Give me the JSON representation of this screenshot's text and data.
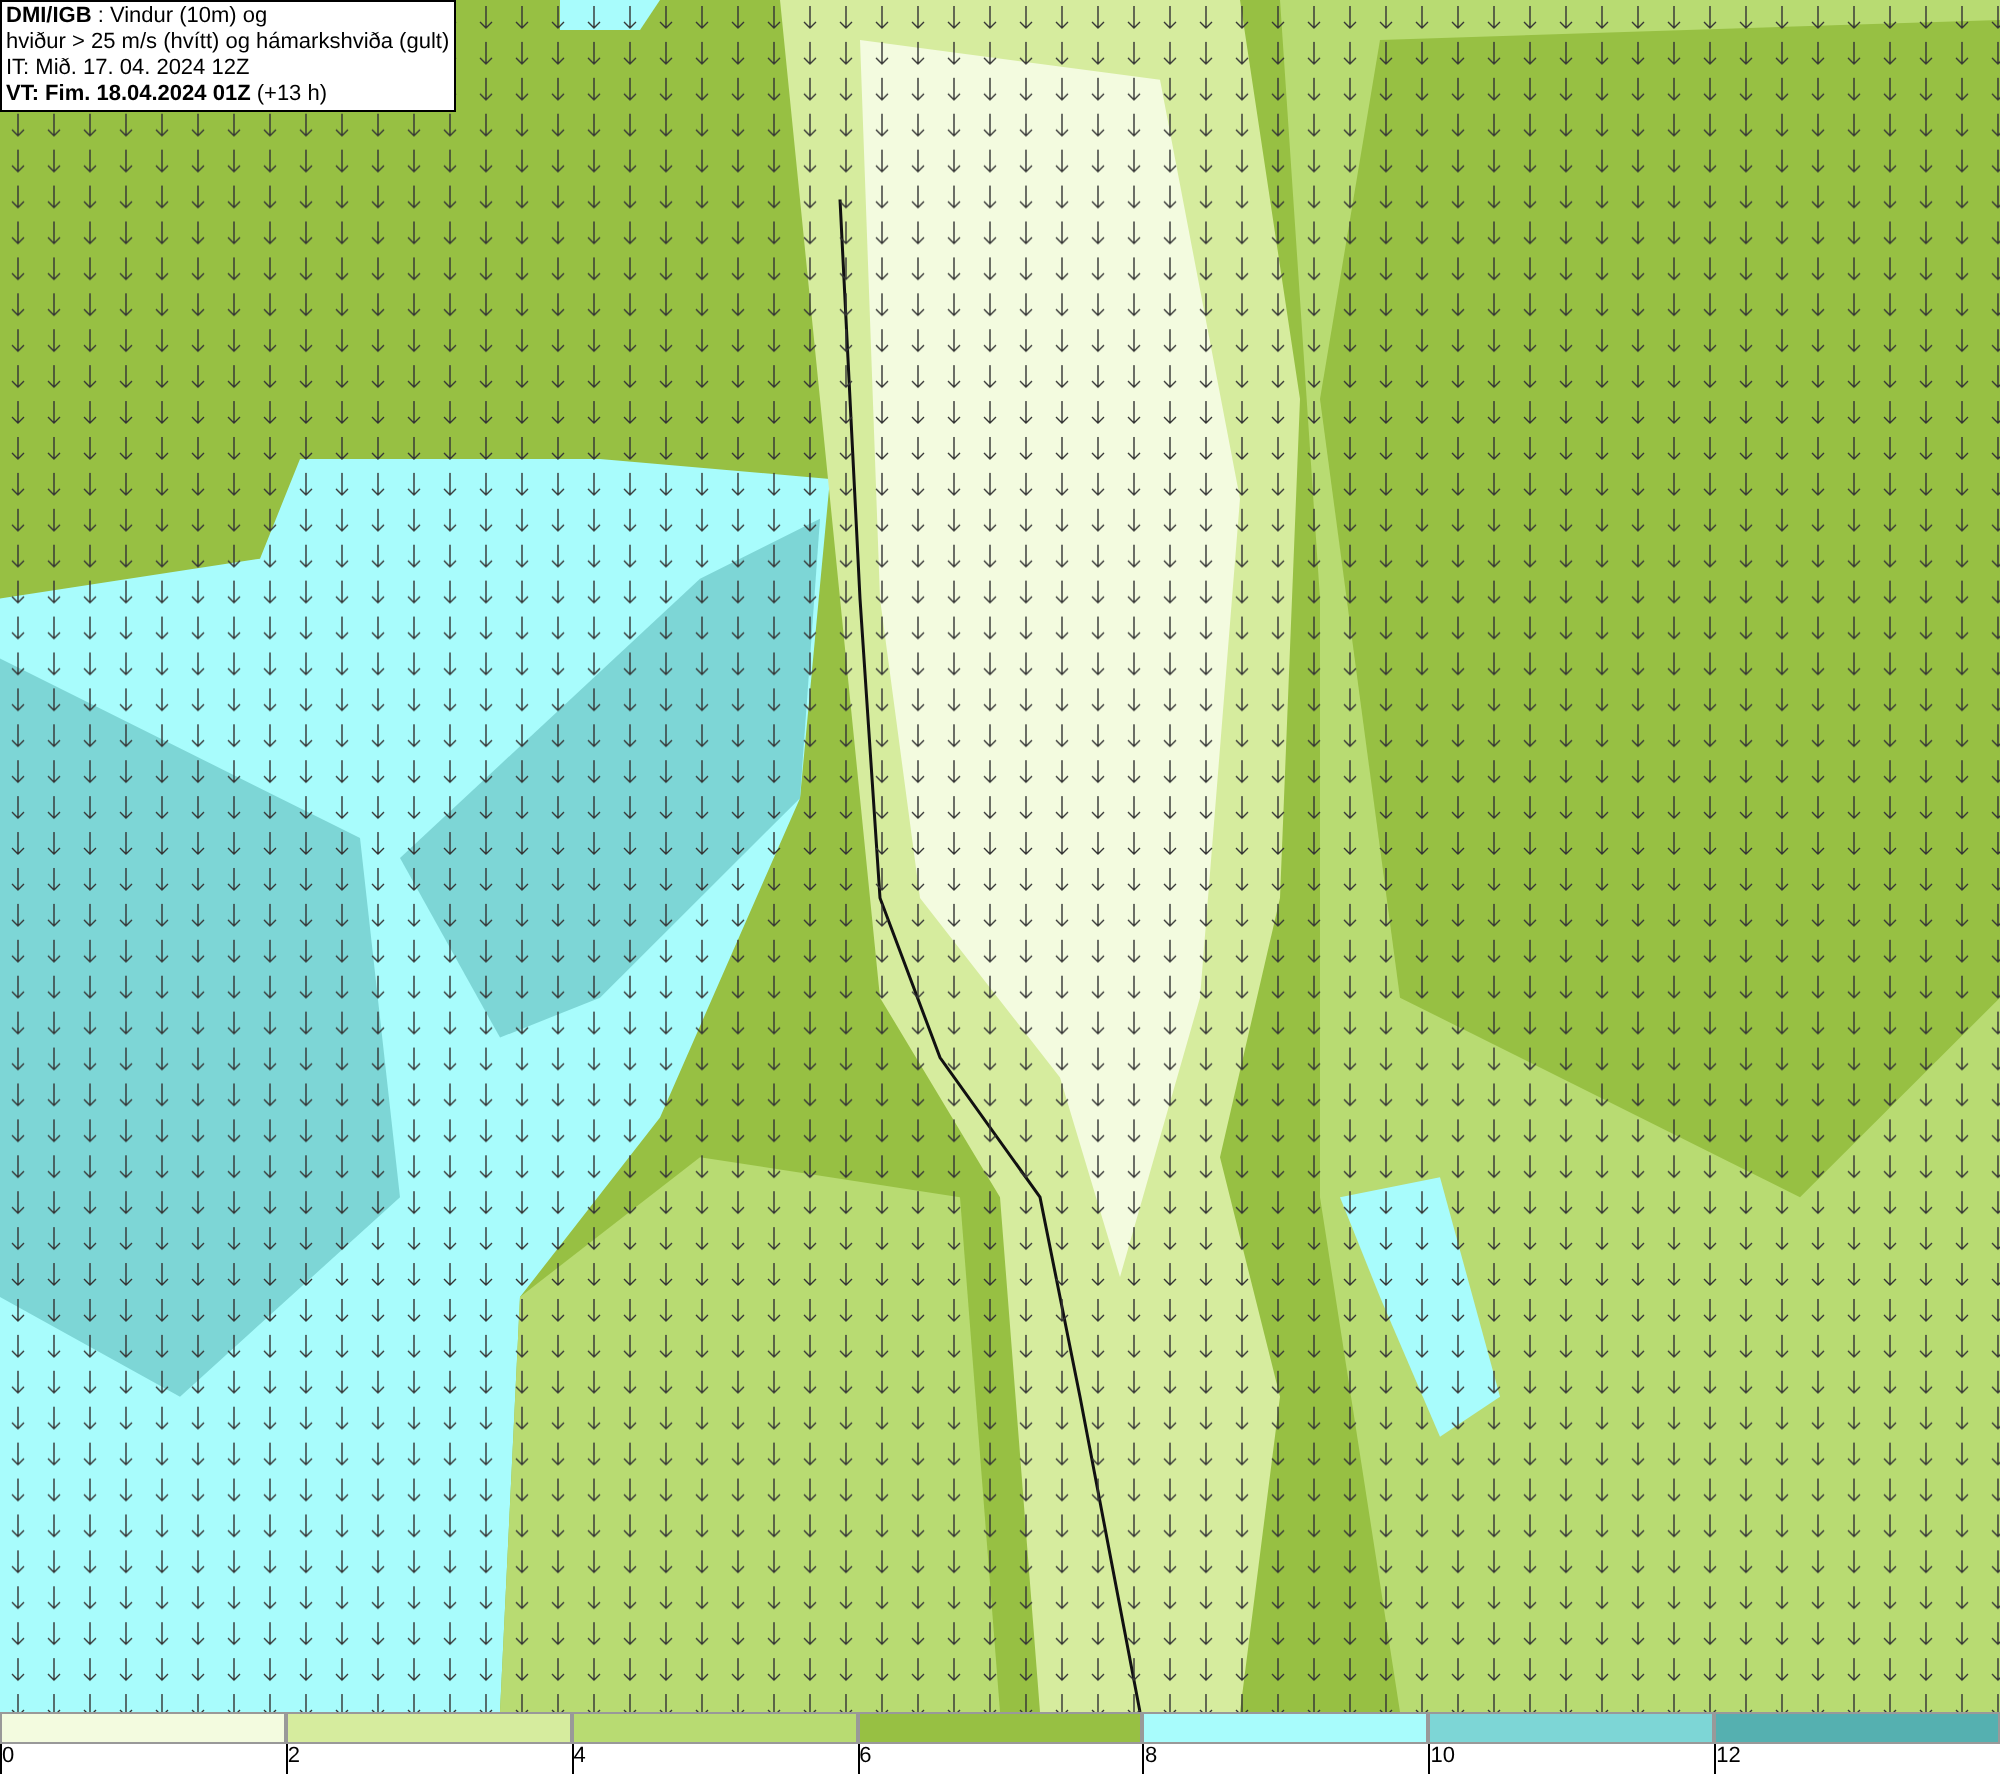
{
  "header": {
    "lines": [
      "**DMI/IGB** : Vindur (10m) og",
      "hviður > 25 m/s (hvítt) og hámarkshviða (gult)",
      "IT: Mið. 17. 04. 2024 12Z",
      "**VT: Fim. 18.04.2024 01Z** (+13 h)"
    ]
  },
  "legend": [
    {
      "color": "#f3fbdf",
      "label": "0"
    },
    {
      "color": "#d6ec9e",
      "label": "2"
    },
    {
      "color": "#b8db72",
      "label": "4"
    },
    {
      "color": "#97c043",
      "label": "6"
    },
    {
      "color": "#a8fcfc",
      "label": "8"
    },
    {
      "color": "#7dd6d6",
      "label": "10"
    },
    {
      "color": "#55b0b0",
      "label": "12"
    }
  ]
}
